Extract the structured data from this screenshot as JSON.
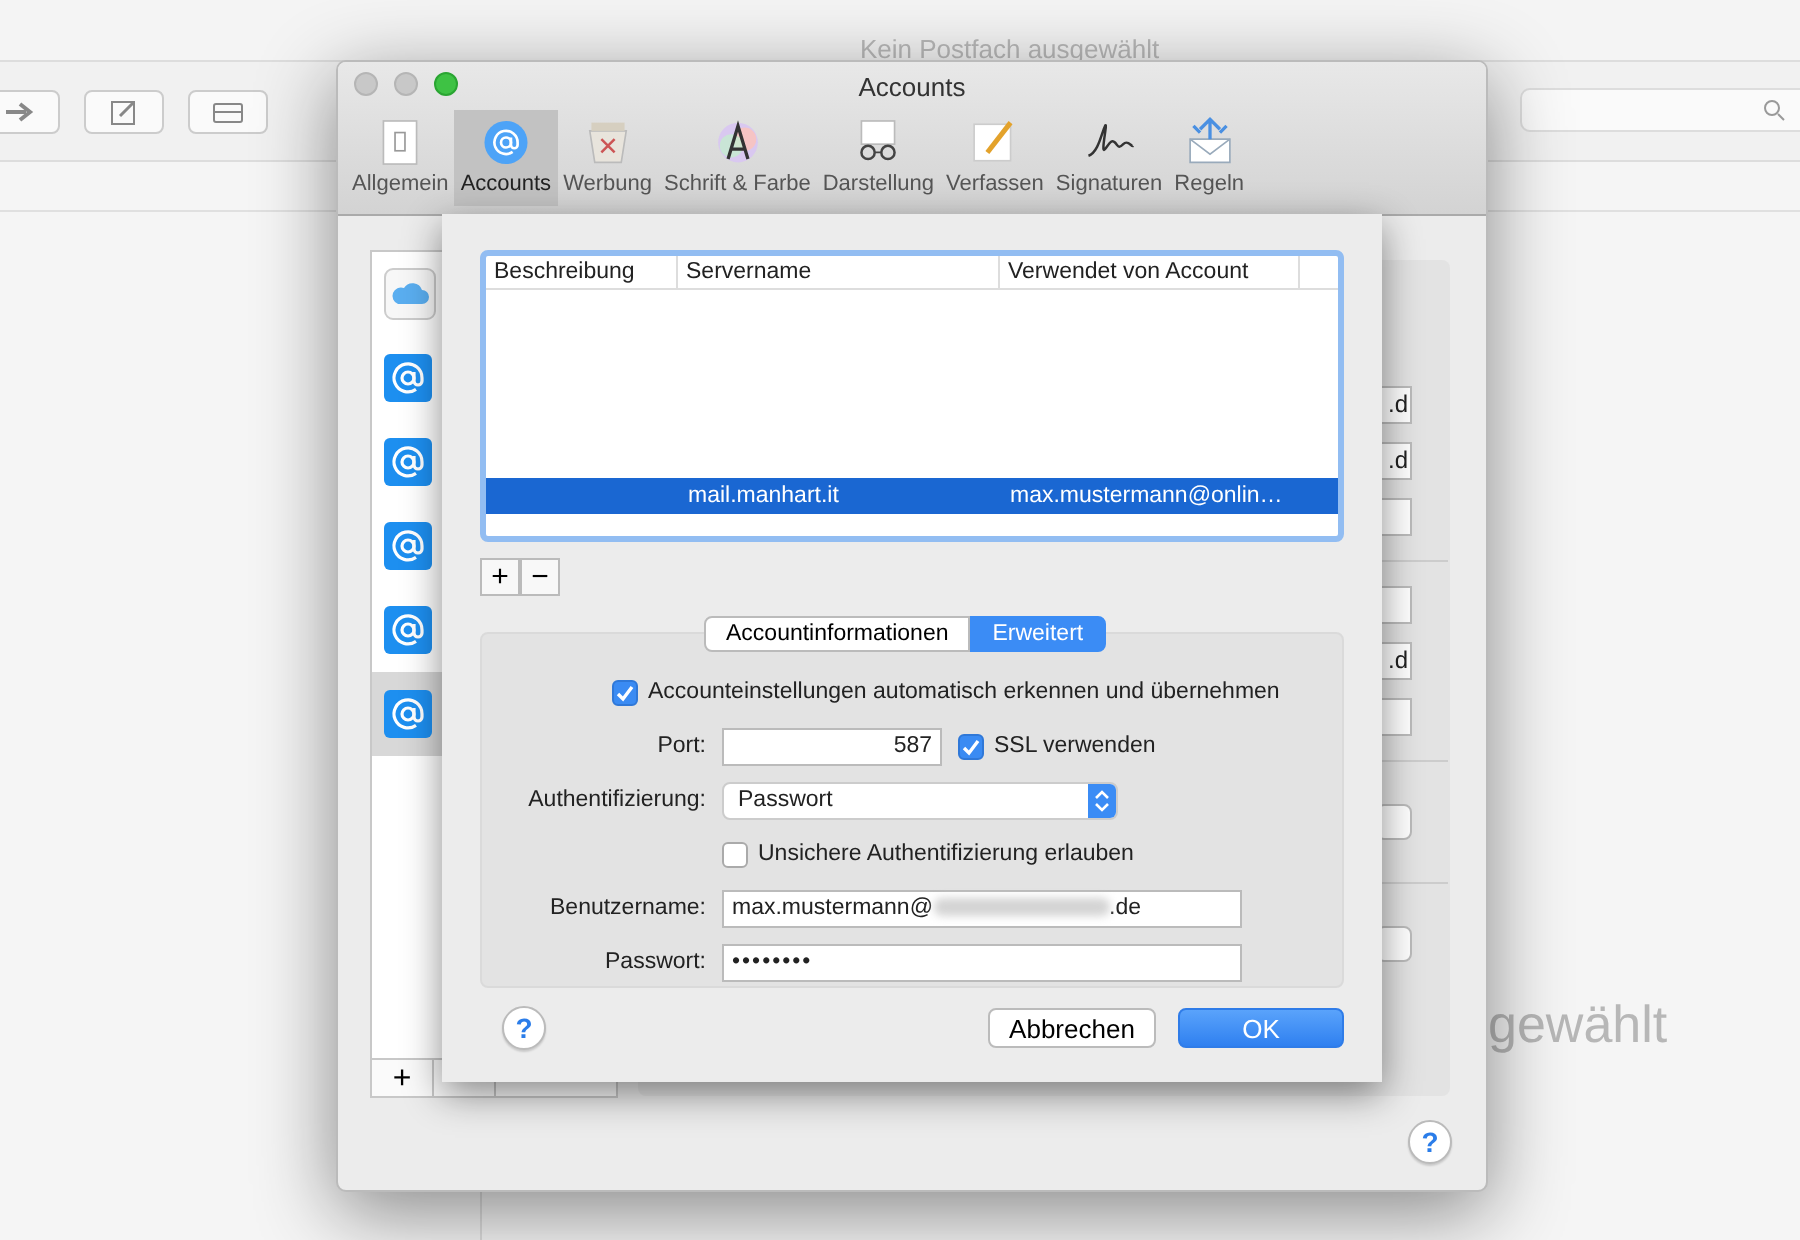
{
  "background_window": {
    "title": "Kein Postfach ausgewählt",
    "empty_message": "gewählt"
  },
  "preferences": {
    "title": "Accounts",
    "toolbar": [
      {
        "label": "Allgemein",
        "kind": "general",
        "selected": false
      },
      {
        "label": "Accounts",
        "kind": "accounts",
        "selected": true
      },
      {
        "label": "Werbung",
        "kind": "junk",
        "selected": false
      },
      {
        "label": "Schrift & Farbe",
        "kind": "fonts",
        "selected": false
      },
      {
        "label": "Darstellung",
        "kind": "viewing",
        "selected": false
      },
      {
        "label": "Verfassen",
        "kind": "composing",
        "selected": false
      },
      {
        "label": "Signaturen",
        "kind": "signatures",
        "selected": false
      },
      {
        "label": "Regeln",
        "kind": "rules",
        "selected": false
      }
    ],
    "account_list": [
      {
        "kind": "icloud",
        "selected": false
      },
      {
        "kind": "mail",
        "selected": false
      },
      {
        "kind": "mail",
        "selected": false
      },
      {
        "kind": "mail",
        "selected": false
      },
      {
        "kind": "mail",
        "selected": false
      },
      {
        "kind": "mail",
        "selected": true
      }
    ],
    "account_list_button": "+",
    "detail_fields": [
      {
        "kind": "text",
        "value": ".d"
      },
      {
        "kind": "text",
        "value": ".d"
      },
      {
        "kind": "empty"
      },
      {
        "kind": "divider"
      },
      {
        "kind": "empty"
      },
      {
        "kind": "text",
        "value": ".d"
      },
      {
        "kind": "empty"
      },
      {
        "kind": "divider"
      },
      {
        "kind": "popup"
      },
      {
        "kind": "divider"
      },
      {
        "kind": "popup"
      }
    ],
    "help": "?"
  },
  "sheet": {
    "table": {
      "columns": [
        "Beschreibung",
        "Servername",
        "Verwendet von Account"
      ],
      "rows": [
        {
          "server": "mail.manhart.it",
          "account": "max.mustermann@onlin…",
          "selected": true
        }
      ]
    },
    "list_buttons": [
      "+",
      "−"
    ],
    "tabs": [
      {
        "label": "Accountinformationen",
        "selected": false
      },
      {
        "label": "Erweitert",
        "selected": true
      }
    ],
    "auto_detect": {
      "label": "Accounteinstellungen automatisch erkennen und übernehmen",
      "checked": true
    },
    "port": {
      "label": "Port:",
      "value": "587"
    },
    "ssl": {
      "label": "SSL verwenden",
      "checked": true
    },
    "auth": {
      "label": "Authentifizierung:",
      "value": "Passwort"
    },
    "insecure": {
      "label": "Unsichere Authentifizierung erlauben",
      "checked": false
    },
    "username": {
      "label": "Benutzername:",
      "value_start": "max.mustermann@",
      "value_end": ".de",
      "redacted": true
    },
    "password": {
      "label": "Passwort:",
      "value": "••••••••"
    },
    "help": "?",
    "buttons": [
      {
        "label": "Abbrechen",
        "kind": "secondary"
      },
      {
        "label": "OK",
        "kind": "primary"
      }
    ]
  }
}
